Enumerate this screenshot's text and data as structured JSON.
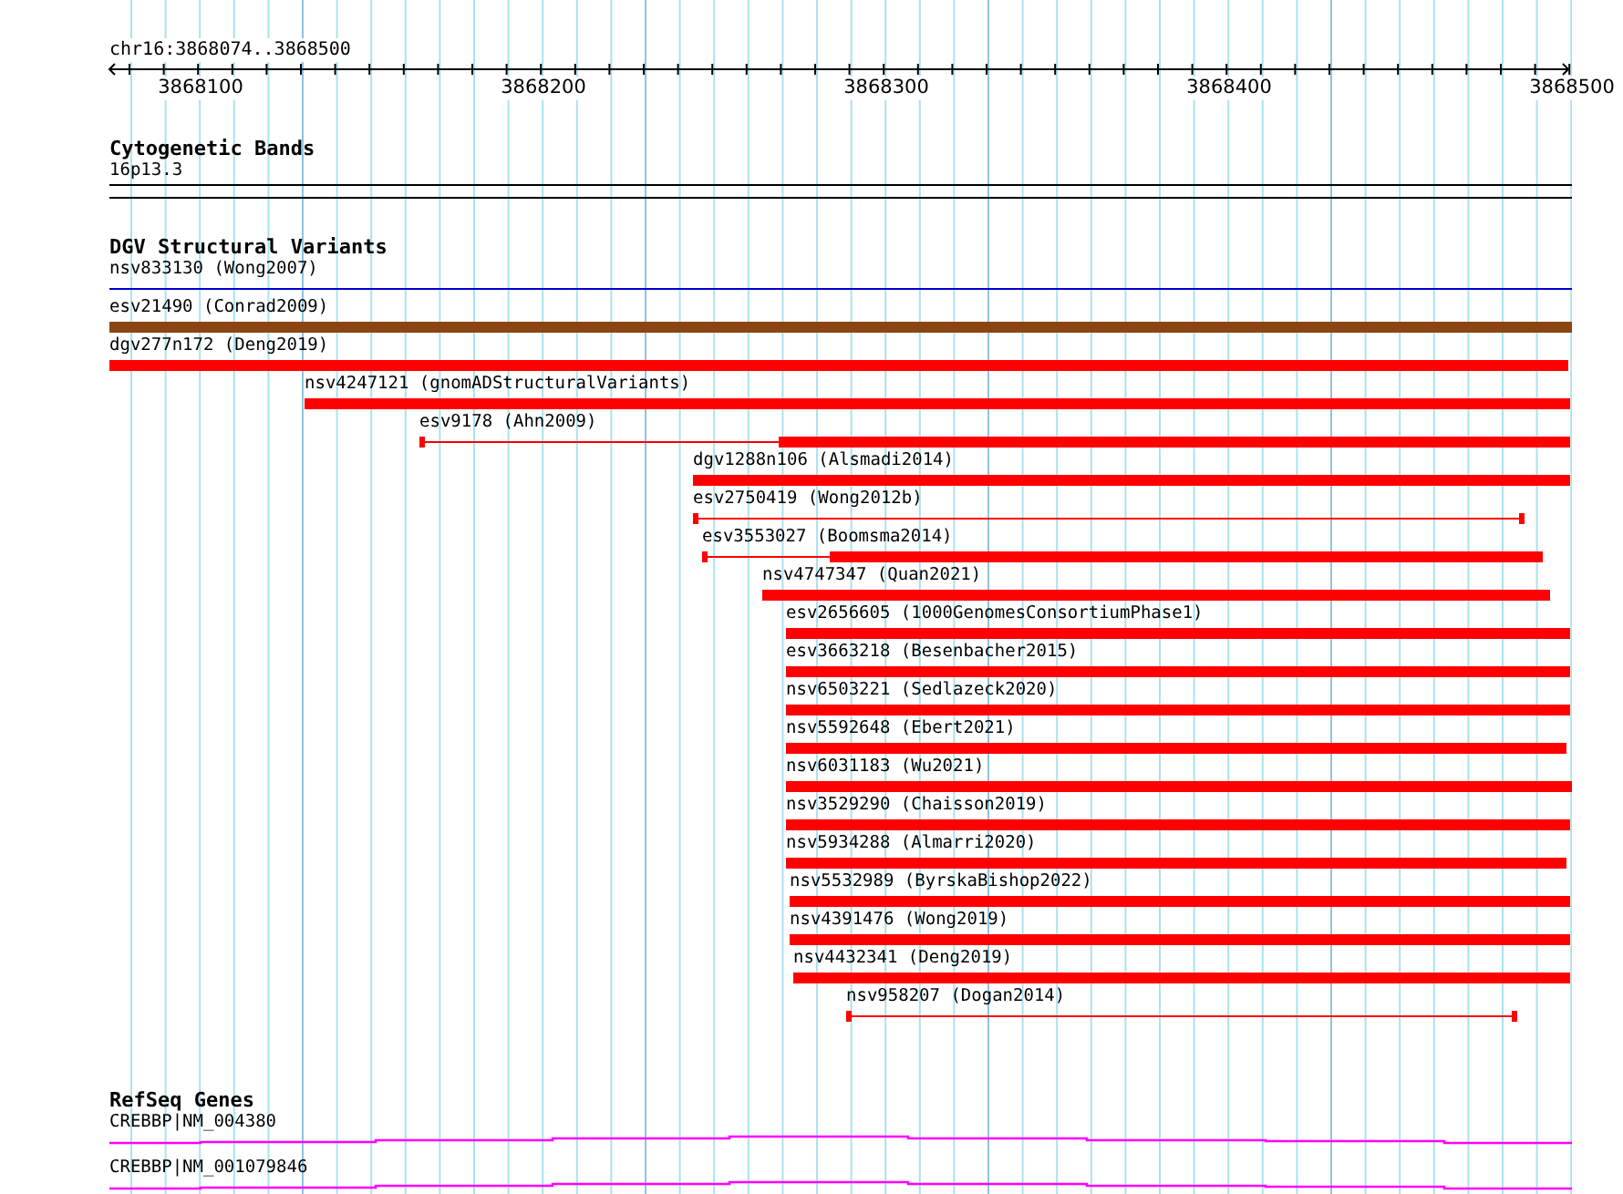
{
  "ruler": {
    "location": "chr16:3868074..3868500",
    "ticks": [
      "3868100",
      "3868200",
      "3868300",
      "3868400",
      "3868500"
    ]
  },
  "tracks": [
    {
      "kind": "bands",
      "title": "Cytogenetic Bands",
      "features": [
        {
          "label": "16p13.3"
        }
      ]
    },
    {
      "kind": "variants",
      "title": "DGV Structural Variants",
      "features": [
        {
          "label": "nsv833130 (Wong2007)",
          "kind": "line",
          "color": "#0000cc"
        },
        {
          "label": "esv21490 (Conrad2009)",
          "kind": "bar",
          "color": "#8b4513"
        },
        {
          "label": "dgv277n172 (Deng2019)",
          "kind": "bar",
          "color": "#ff0000"
        },
        {
          "label": "nsv4247121 (gnomADStructuralVariants)",
          "kind": "bar",
          "color": "#ff0000"
        },
        {
          "label": "esv9178 (Ahn2009)",
          "kind": "mixed",
          "color": "#ff0000"
        },
        {
          "label": "dgv1288n106 (Alsmadi2014)",
          "kind": "bar",
          "color": "#ff0000"
        },
        {
          "label": "esv2750419 (Wong2012b)",
          "kind": "line",
          "color": "#ff0000"
        },
        {
          "label": "esv3553027 (Boomsma2014)",
          "kind": "mixed",
          "color": "#ff0000"
        },
        {
          "label": "nsv4747347 (Quan2021)",
          "kind": "bar",
          "color": "#ff0000"
        },
        {
          "label": "esv2656605 (1000GenomesConsortiumPhase1)",
          "kind": "bar",
          "color": "#ff0000"
        },
        {
          "label": "esv3663218 (Besenbacher2015)",
          "kind": "bar",
          "color": "#ff0000"
        },
        {
          "label": "nsv6503221 (Sedlazeck2020)",
          "kind": "bar",
          "color": "#ff0000"
        },
        {
          "label": "nsv5592648 (Ebert2021)",
          "kind": "bar",
          "color": "#ff0000"
        },
        {
          "label": "nsv6031183 (Wu2021)",
          "kind": "bar",
          "color": "#ff0000"
        },
        {
          "label": "nsv3529290 (Chaisson2019)",
          "kind": "bar",
          "color": "#ff0000"
        },
        {
          "label": "nsv5934288 (Almarri2020)",
          "kind": "bar",
          "color": "#ff0000"
        },
        {
          "label": "nsv5532989 (ByrskaBishop2022)",
          "kind": "bar",
          "color": "#ff0000"
        },
        {
          "label": "nsv4391476 (Wong2019)",
          "kind": "bar",
          "color": "#ff0000"
        },
        {
          "label": "nsv4432341 (Deng2019)",
          "kind": "bar",
          "color": "#ff0000"
        },
        {
          "label": "nsv958207 (Dogan2014)",
          "kind": "line",
          "color": "#ff0000"
        }
      ]
    },
    {
      "kind": "genes",
      "title": "RefSeq Genes",
      "features": [
        {
          "label": "CREBBP|NM_004380"
        },
        {
          "label": "CREBBP|NM_001079846"
        }
      ]
    }
  ]
}
